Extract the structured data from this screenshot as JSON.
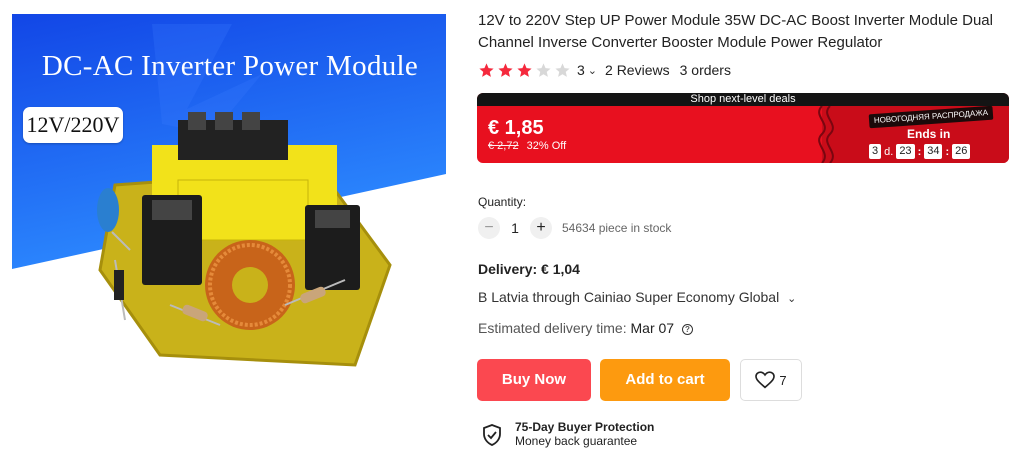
{
  "image": {
    "banner_title": "DC-AC Inverter Power Module",
    "voltage_tag": "12V/220V",
    "colors": {
      "banner_top": "#1246e6",
      "banner_bottom": "#3ea8ff"
    }
  },
  "product": {
    "title": "12V to 220V Step UP Power Module 35W DC-AC Boost Inverter Module Dual Channel Inverse Converter Booster Module Power Regulator",
    "rating": {
      "stars_filled": 3,
      "stars_total": 5,
      "value": "3",
      "chevron": "⌄",
      "reviews": "2 Reviews",
      "orders": "3 orders",
      "star_color": "#f5293d",
      "star_empty_color": "#d8d8d8"
    }
  },
  "deal": {
    "strip_text": "Shop next-level deals",
    "price": "€ 1,85",
    "old_price": "€ 2,72",
    "discount": "32% Off",
    "sale_tag": "НОВОГОДНЯЯ РАСПРОДАЖА",
    "ends_label": "Ends in",
    "timer": {
      "days": "3",
      "days_unit": "d.",
      "hours": "23",
      "minutes": "34",
      "seconds": "26",
      "sep": ":"
    },
    "colors": {
      "accent": "#e8101f",
      "strip": "#141414"
    }
  },
  "quantity": {
    "label": "Quantity:",
    "minus": "−",
    "value": "1",
    "plus": "+",
    "stock": "54634 piece in stock"
  },
  "shipping": {
    "delivery": "Delivery: € 1,04",
    "route": "B Latvia through Cainiao Super Economy Global",
    "route_chevron": "⌄",
    "estimate_label": "Estimated delivery time:",
    "estimate_value": "Mar 07",
    "help_icon": "?"
  },
  "actions": {
    "buy_now": "Buy Now",
    "add_to_cart": "Add to cart",
    "wishlist_count": "7",
    "colors": {
      "buy": "#fb4850",
      "cart": "#fd9a0f"
    }
  },
  "protection": {
    "title": "75-Day Buyer Protection",
    "subtitle": "Money back guarantee"
  }
}
